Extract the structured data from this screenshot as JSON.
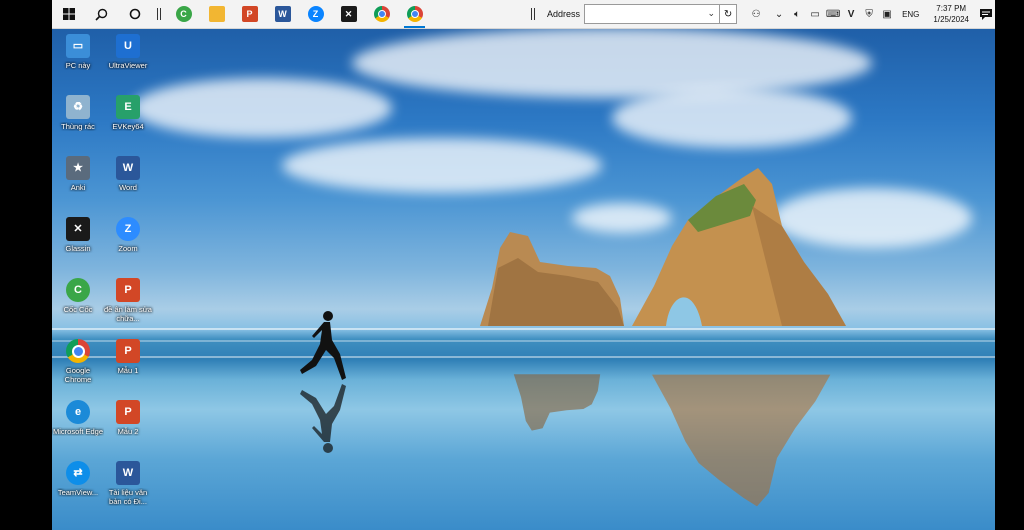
{
  "taskbar": {
    "address_label": "Address",
    "address_value": "",
    "language": "ENG",
    "time": "7:37 PM",
    "date": "1/25/2024",
    "pinned": [
      {
        "name": "coc-coc",
        "icon": "coccoc-icon",
        "color": "#3aa648",
        "glyph": "C"
      },
      {
        "name": "file-explorer",
        "icon": "folder-icon",
        "color": "#f2b632",
        "glyph": ""
      },
      {
        "name": "powerpoint",
        "icon": "powerpoint-icon",
        "color": "#d24726",
        "glyph": "P"
      },
      {
        "name": "word",
        "icon": "word-icon",
        "color": "#2b579a",
        "glyph": "W"
      },
      {
        "name": "zalo",
        "icon": "zalo-icon",
        "color": "#0a84ff",
        "glyph": "Z"
      },
      {
        "name": "capcut",
        "icon": "capcut-icon",
        "color": "#1a1a1a",
        "glyph": "✕"
      },
      {
        "name": "chrome",
        "icon": "chrome-icon",
        "color": "#db4437",
        "glyph": ""
      },
      {
        "name": "chrome-2",
        "icon": "chrome-icon",
        "color": "#db4437",
        "glyph": ""
      }
    ]
  },
  "desktop_icons": [
    {
      "label": "PC này",
      "icon": "pc-icon",
      "color": "#3b8ed8",
      "glyph": "▭"
    },
    {
      "label": "UltraViewer",
      "icon": "ultraviewer-icon",
      "color": "#1e6fd1",
      "glyph": "U"
    },
    {
      "label": "Thùng rác",
      "icon": "recycle-bin-icon",
      "color": "#8fb3cf",
      "glyph": "♻"
    },
    {
      "label": "EVKey64",
      "icon": "evkey-icon",
      "color": "#27a06a",
      "glyph": "E"
    },
    {
      "label": "Anki",
      "icon": "anki-icon",
      "color": "#5a6b7d",
      "glyph": "★"
    },
    {
      "label": "Word",
      "icon": "word-icon",
      "color": "#2b579a",
      "glyph": "W"
    },
    {
      "label": "Glassin",
      "icon": "glassin-icon",
      "color": "#1a1a1a",
      "glyph": "✕"
    },
    {
      "label": "Zoom",
      "icon": "zoom-icon",
      "color": "#2d8cff",
      "glyph": "Z"
    },
    {
      "label": "Cốc Cốc",
      "icon": "coccoc-icon",
      "color": "#3aa648",
      "glyph": "C"
    },
    {
      "label": "đề ân làm sửa chữa...",
      "icon": "powerpoint-file-icon",
      "color": "#d24726",
      "glyph": "P"
    },
    {
      "label": "Google Chrome",
      "icon": "chrome-icon",
      "color": "#db4437",
      "glyph": "●"
    },
    {
      "label": "Mẫu 1",
      "icon": "powerpoint-file-icon",
      "color": "#d24726",
      "glyph": "P"
    },
    {
      "label": "Microsoft Edge",
      "icon": "edge-icon",
      "color": "#1b8ad8",
      "glyph": "e"
    },
    {
      "label": "Mẫu 2",
      "icon": "powerpoint-file-icon",
      "color": "#d24726",
      "glyph": "P"
    },
    {
      "label": "TeamView...",
      "icon": "teamviewer-icon",
      "color": "#0e8ee9",
      "glyph": "⇄"
    },
    {
      "label": "Tài liệu văn bản có Đi...",
      "icon": "word-file-icon",
      "color": "#2b579a",
      "glyph": "W"
    }
  ]
}
